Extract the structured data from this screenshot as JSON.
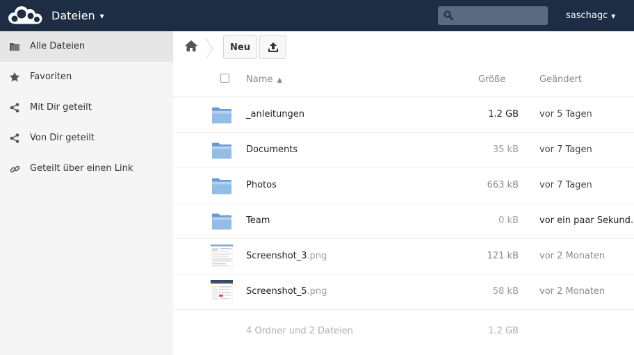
{
  "header": {
    "app_title": "Dateien",
    "caret": "▾",
    "username": "saschagc",
    "search_placeholder": ""
  },
  "sidebar": {
    "items": [
      {
        "label": "Alle Dateien",
        "icon": "folder-icon",
        "active": true
      },
      {
        "label": "Favoriten",
        "icon": "star-icon",
        "active": false
      },
      {
        "label": "Mit Dir geteilt",
        "icon": "share-icon",
        "active": false
      },
      {
        "label": "Von Dir geteilt",
        "icon": "share-icon",
        "active": false
      },
      {
        "label": "Geteilt über einen Link",
        "icon": "link-icon",
        "active": false
      }
    ]
  },
  "controls": {
    "new_label": "Neu"
  },
  "table": {
    "headers": {
      "name": "Name",
      "sort_arrow": "▲",
      "size": "Größe",
      "modified": "Geändert"
    },
    "rows": [
      {
        "name": "_anleitungen",
        "ext": "",
        "type": "folder",
        "size": "1.2 GB",
        "modified": "vor 5 Tagen",
        "size_color": "#222222",
        "mod_color": "#444444"
      },
      {
        "name": "Documents",
        "ext": "",
        "type": "folder",
        "size": "35 kB",
        "modified": "vor 7 Tagen",
        "size_color": "#9a9a9a",
        "mod_color": "#444444"
      },
      {
        "name": "Photos",
        "ext": "",
        "type": "folder",
        "size": "663 kB",
        "modified": "vor 7 Tagen",
        "size_color": "#8a8a8a",
        "mod_color": "#444444"
      },
      {
        "name": "Team",
        "ext": "",
        "type": "folder",
        "size": "0 kB",
        "modified": "vor ein paar Sekund…",
        "size_color": "#a0a0a0",
        "mod_color": "#222222"
      },
      {
        "name": "Screenshot_3",
        "ext": ".png",
        "type": "image",
        "size": "121 kB",
        "modified": "vor 2 Monaten",
        "size_color": "#8a8a8a",
        "mod_color": "#8a8a8a"
      },
      {
        "name": "Screenshot_5",
        "ext": ".png",
        "type": "image",
        "size": "58 kB",
        "modified": "vor 2 Monaten",
        "size_color": "#9a9a9a",
        "mod_color": "#8a8a8a"
      }
    ],
    "summary": {
      "text": "4 Ordner und 2 Dateien",
      "size": "1.2 GB"
    }
  },
  "colors": {
    "header_bg": "#1d2d44",
    "sidebar_bg": "#f5f5f5",
    "sidebar_active": "#e6e6e6",
    "folder_blue": "#8cb7e0"
  }
}
